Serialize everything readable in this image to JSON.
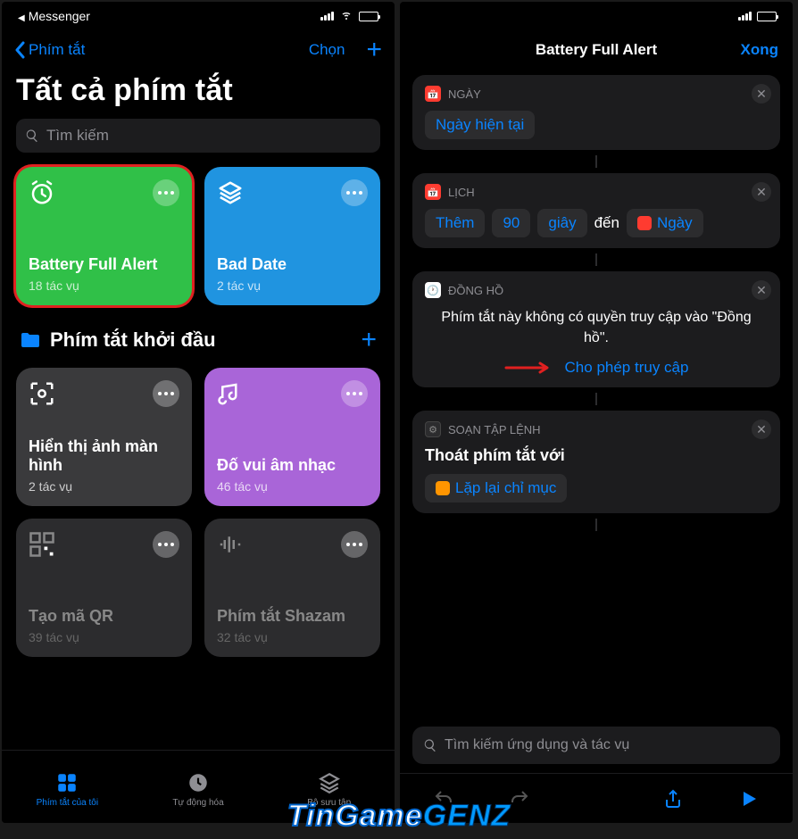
{
  "left": {
    "status": {
      "app": "Messenger"
    },
    "nav": {
      "back": "Phím tắt",
      "select": "Chọn"
    },
    "title": "Tất cả phím tắt",
    "search": "Tìm kiếm",
    "tiles": [
      {
        "name": "Battery Full Alert",
        "sub": "18 tác vụ",
        "color": "green",
        "highlight": true
      },
      {
        "name": "Bad Date",
        "sub": "2 tác vụ",
        "color": "blue"
      }
    ],
    "section": "Phím tắt khởi đầu",
    "tiles2": [
      {
        "name": "Hiển thị ảnh màn hình",
        "sub": "2 tác vụ",
        "color": "gray"
      },
      {
        "name": "Đố vui âm nhạc",
        "sub": "46 tác vụ",
        "color": "purple"
      },
      {
        "name": "Tạo mã QR",
        "sub": "39 tác vụ",
        "color": "dg1"
      },
      {
        "name": "Phím tắt Shazam",
        "sub": "32 tác vụ",
        "color": "dg2"
      }
    ],
    "tabs": [
      {
        "label": "Phím tắt của tôi",
        "active": true
      },
      {
        "label": "Tự động hóa",
        "active": false
      },
      {
        "label": "Bộ sưu tập",
        "active": false
      }
    ]
  },
  "right": {
    "nav": {
      "title": "Battery Full Alert",
      "done": "Xong"
    },
    "cards": {
      "c1": {
        "head": "NGÀY",
        "pill": "Ngày hiện tại"
      },
      "c2": {
        "head": "LỊCH",
        "p1": "Thêm",
        "p2": "90",
        "p3": "giây",
        "w": "đến",
        "p4": "Ngày"
      },
      "c3": {
        "head": "ĐỒNG HỒ",
        "msg": "Phím tắt này không có quyền truy cập vào \"Đồng hồ\".",
        "allow": "Cho phép truy cập"
      },
      "c4": {
        "head": "SOẠN TẬP LỆNH",
        "w": "Thoát phím tắt với",
        "p": "Lặp lại chỉ mục"
      }
    },
    "search": "Tìm kiếm ứng dụng và tác vụ"
  },
  "watermark": {
    "p1": "TinGame",
    "p2": "GENZ"
  }
}
